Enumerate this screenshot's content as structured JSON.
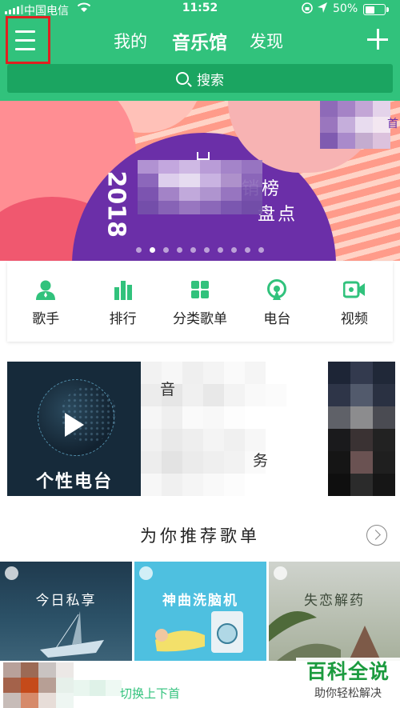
{
  "status_bar": {
    "carrier": "中国电信",
    "time": "11:52",
    "battery": "50%",
    "battery_level": 0.5
  },
  "header": {
    "tabs": [
      "我的",
      "音乐馆",
      "发现"
    ],
    "active_tab": "音乐馆"
  },
  "search": {
    "placeholder": "搜索"
  },
  "banner": {
    "year": "2018",
    "title_line1": "销榜",
    "title_line2": "盘点",
    "corner_text": "首",
    "dot_count": 10,
    "active_dot": 1
  },
  "categories": [
    {
      "label": "歌手",
      "icon": "singer-icon"
    },
    {
      "label": "排行",
      "icon": "chart-bars-icon"
    },
    {
      "label": "分类歌单",
      "icon": "grid-icon"
    },
    {
      "label": "电台",
      "icon": "radio-icon"
    },
    {
      "label": "视频",
      "icon": "video-camera-icon"
    }
  ],
  "radio_card": {
    "label": "个性电台"
  },
  "recommend_lines": [
    "音",
    "务"
  ],
  "section": {
    "title": "为你推荐歌单"
  },
  "playlists": [
    {
      "title": "今日私享"
    },
    {
      "title": "神曲洗脑机"
    },
    {
      "title": "失恋解药"
    }
  ],
  "bottom_bar": {
    "hint": "切换上下首"
  },
  "watermark": {
    "line1": "百科全说",
    "line2": "助你轻松解决"
  },
  "colors": {
    "brand_green": "#31c27c",
    "search_bg": "#1ba561",
    "highlight_box": "#e02020"
  }
}
